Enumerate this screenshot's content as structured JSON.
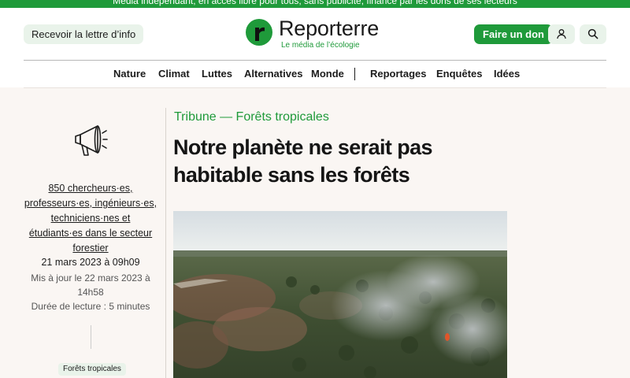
{
  "topbar": {
    "text": "Média indépendant, en accès libre pour tous, sans publicité, financé par les dons de ses lecteurs"
  },
  "header": {
    "newsletter_label": "Recevoir la lettre d’info",
    "logo_name": "Reporterre",
    "logo_tagline": "Le média de l’écologie",
    "donate_label": "Faire un don",
    "account_icon": "user-icon",
    "search_icon": "search-icon"
  },
  "nav": {
    "items": [
      "Nature",
      "Climat",
      "Luttes",
      "Alternatives",
      "Monde",
      "Reportages",
      "Enquêtes",
      "Idées"
    ]
  },
  "sidebar": {
    "icon": "megaphone-icon",
    "author": "850 chercheurs·es, professeurs·es, ingénieurs·es, techniciens·nes et étudiants·es dans le secteur forestier",
    "date": "21 mars 2023 à 09h09",
    "updated": "Mis à jour le 22 mars 2023 à 14h58",
    "reading_time": "Durée de lecture : 5 minutes",
    "tag": "Forêts tropicales"
  },
  "article": {
    "kicker": "Tribune — Forêts tropicales",
    "title": "Notre planète ne serait pas habitable sans les forêts"
  },
  "colors": {
    "brand_green": "#1f9a3a",
    "soft_green": "#e9f3ea",
    "content_bg": "#faf6f3"
  }
}
